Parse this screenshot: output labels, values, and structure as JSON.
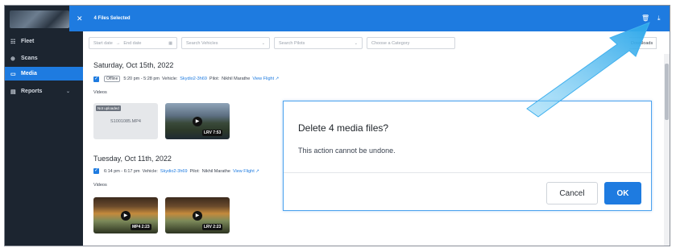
{
  "sidebar": {
    "items": [
      {
        "label": "Fleet",
        "icon": "fleet-icon",
        "glyph": "☷"
      },
      {
        "label": "Scans",
        "icon": "scans-icon",
        "glyph": "⊕"
      },
      {
        "label": "Media",
        "icon": "media-icon",
        "glyph": "▭"
      },
      {
        "label": "Reports",
        "icon": "reports-icon",
        "glyph": "▤"
      }
    ]
  },
  "topbar": {
    "close_glyph": "✕",
    "selection_label": "4 Files Selected",
    "delete_glyph": "🗑",
    "download_glyph": "⤓"
  },
  "filters": {
    "start_date": "Start date",
    "arrow": "→",
    "end_date": "End date",
    "calendar_glyph": "▦",
    "vehicles": "Search Vehicles",
    "pilots": "Search Pilots",
    "category": "Choose a Category",
    "caret": "⌄",
    "downloads": "Downloads"
  },
  "groups": [
    {
      "date": "Saturday, Oct 15th, 2022",
      "status": "Offline",
      "time": "5:20 pm - 5:28 pm",
      "vehicle_label": "Vehicle:",
      "vehicle": "Skydio2-3h69",
      "pilot_label": "Pilot:",
      "pilot": "Nikhil Marathe",
      "view_flight": "View Flight ↗",
      "section": "Videos",
      "media": [
        {
          "badge": "Not uploaded",
          "filename": "S1001085.MP4"
        },
        {
          "tag": "LRV  7:53"
        }
      ]
    },
    {
      "date": "Tuesday, Oct 11th, 2022",
      "time": "6:14 pm - 6:17 pm",
      "vehicle_label": "Vehicle:",
      "vehicle": "Skydio2-3h69",
      "pilot_label": "Pilot:",
      "pilot": "Nikhil Marathe",
      "view_flight": "View Flight ↗",
      "section": "Videos",
      "media": [
        {
          "tag": "MP4  2:23"
        },
        {
          "tag": "LRV  2:23"
        }
      ]
    }
  ],
  "dialog": {
    "title": "Delete 4 media files?",
    "body": "This action cannot be undone.",
    "cancel": "Cancel",
    "ok": "OK"
  },
  "colors": {
    "accent": "#1e7be0",
    "sidebar": "#1c2530",
    "arrow": "#3fb0ee"
  }
}
